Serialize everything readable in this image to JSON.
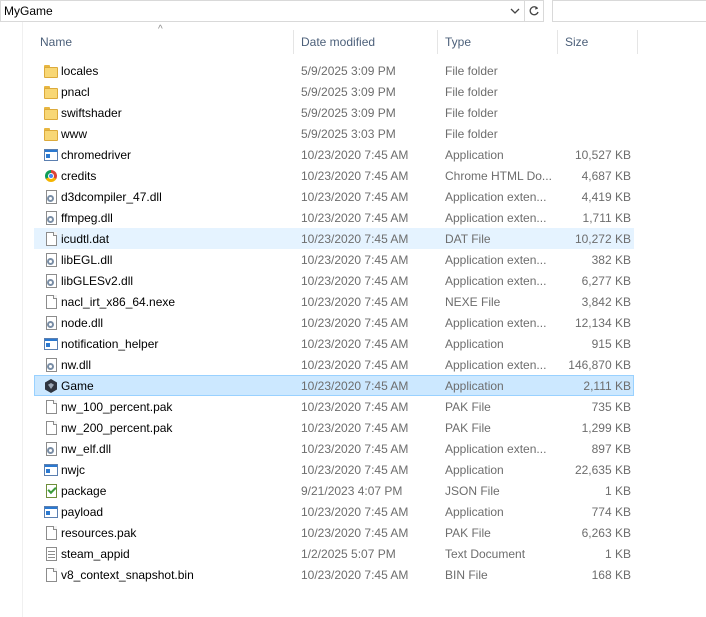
{
  "address": {
    "path": "MyGame",
    "dropdown_icon": "chevron-down-icon",
    "refresh_icon": "refresh-icon"
  },
  "search": {
    "placeholder": ""
  },
  "columns": {
    "name": "Name",
    "date": "Date modified",
    "type": "Type",
    "size": "Size",
    "sort_indicator": "^"
  },
  "files": [
    {
      "name": "locales",
      "date": "5/9/2025 3:09 PM",
      "type": "File folder",
      "size": "",
      "icon": "folder-icon"
    },
    {
      "name": "pnacl",
      "date": "5/9/2025 3:09 PM",
      "type": "File folder",
      "size": "",
      "icon": "folder-icon"
    },
    {
      "name": "swiftshader",
      "date": "5/9/2025 3:09 PM",
      "type": "File folder",
      "size": "",
      "icon": "folder-icon"
    },
    {
      "name": "www",
      "date": "5/9/2025 3:03 PM",
      "type": "File folder",
      "size": "",
      "icon": "folder-icon"
    },
    {
      "name": "chromedriver",
      "date": "10/23/2020 7:45 AM",
      "type": "Application",
      "size": "10,527 KB",
      "icon": "application-icon"
    },
    {
      "name": "credits",
      "date": "10/23/2020 7:45 AM",
      "type": "Chrome HTML Do...",
      "size": "4,687 KB",
      "icon": "chrome-icon"
    },
    {
      "name": "d3dcompiler_47.dll",
      "date": "10/23/2020 7:45 AM",
      "type": "Application exten...",
      "size": "4,419 KB",
      "icon": "dll-icon"
    },
    {
      "name": "ffmpeg.dll",
      "date": "10/23/2020 7:45 AM",
      "type": "Application exten...",
      "size": "1,711 KB",
      "icon": "dll-icon"
    },
    {
      "name": "icudtl.dat",
      "date": "10/23/2020 7:45 AM",
      "type": "DAT File",
      "size": "10,272 KB",
      "icon": "file-icon",
      "state": "hover"
    },
    {
      "name": "libEGL.dll",
      "date": "10/23/2020 7:45 AM",
      "type": "Application exten...",
      "size": "382 KB",
      "icon": "dll-icon"
    },
    {
      "name": "libGLESv2.dll",
      "date": "10/23/2020 7:45 AM",
      "type": "Application exten...",
      "size": "6,277 KB",
      "icon": "dll-icon"
    },
    {
      "name": "nacl_irt_x86_64.nexe",
      "date": "10/23/2020 7:45 AM",
      "type": "NEXE File",
      "size": "3,842 KB",
      "icon": "file-icon"
    },
    {
      "name": "node.dll",
      "date": "10/23/2020 7:45 AM",
      "type": "Application exten...",
      "size": "12,134 KB",
      "icon": "dll-icon"
    },
    {
      "name": "notification_helper",
      "date": "10/23/2020 7:45 AM",
      "type": "Application",
      "size": "915 KB",
      "icon": "application-icon"
    },
    {
      "name": "nw.dll",
      "date": "10/23/2020 7:45 AM",
      "type": "Application exten...",
      "size": "146,870 KB",
      "icon": "dll-icon"
    },
    {
      "name": "Game",
      "date": "10/23/2020 7:45 AM",
      "type": "Application",
      "size": "2,111 KB",
      "icon": "game-icon",
      "state": "selected"
    },
    {
      "name": "nw_100_percent.pak",
      "date": "10/23/2020 7:45 AM",
      "type": "PAK File",
      "size": "735 KB",
      "icon": "file-icon"
    },
    {
      "name": "nw_200_percent.pak",
      "date": "10/23/2020 7:45 AM",
      "type": "PAK File",
      "size": "1,299 KB",
      "icon": "file-icon"
    },
    {
      "name": "nw_elf.dll",
      "date": "10/23/2020 7:45 AM",
      "type": "Application exten...",
      "size": "897 KB",
      "icon": "dll-icon"
    },
    {
      "name": "nwjc",
      "date": "10/23/2020 7:45 AM",
      "type": "Application",
      "size": "22,635 KB",
      "icon": "application-icon"
    },
    {
      "name": "package",
      "date": "9/21/2023 4:07 PM",
      "type": "JSON File",
      "size": "1 KB",
      "icon": "json-icon"
    },
    {
      "name": "payload",
      "date": "10/23/2020 7:45 AM",
      "type": "Application",
      "size": "774 KB",
      "icon": "application-icon"
    },
    {
      "name": "resources.pak",
      "date": "10/23/2020 7:45 AM",
      "type": "PAK File",
      "size": "6,263 KB",
      "icon": "file-icon"
    },
    {
      "name": "steam_appid",
      "date": "1/2/2025 5:07 PM",
      "type": "Text Document",
      "size": "1 KB",
      "icon": "text-icon"
    },
    {
      "name": "v8_context_snapshot.bin",
      "date": "10/23/2020 7:45 AM",
      "type": "BIN File",
      "size": "168 KB",
      "icon": "file-icon"
    }
  ]
}
